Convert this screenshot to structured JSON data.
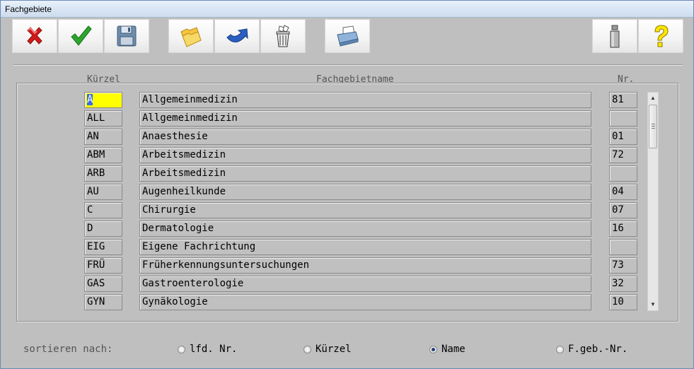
{
  "window": {
    "title": "Fachgebiete"
  },
  "toolbar": [
    {
      "name": "cancel-button",
      "icon": "red-x-icon"
    },
    {
      "name": "confirm-button",
      "icon": "green-check-icon"
    },
    {
      "name": "save-button",
      "icon": "floppy-disk-icon"
    },
    {
      "name": "open-folder-button",
      "icon": "folders-icon"
    },
    {
      "name": "undo-button",
      "icon": "undo-arrow-icon"
    },
    {
      "name": "delete-button",
      "icon": "trash-can-icon"
    },
    {
      "name": "print-button",
      "icon": "printer-icon"
    },
    {
      "name": "info-button",
      "icon": "info-icon"
    },
    {
      "name": "help-button",
      "icon": "question-mark-icon"
    }
  ],
  "columns": {
    "kuerzel": "Kürzel",
    "name": "Fachgebietname",
    "nr": "Nr."
  },
  "rows": [
    {
      "kuerzel": "A",
      "name": "Allgemeinmedizin",
      "nr": "81"
    },
    {
      "kuerzel": "ALL",
      "name": "Allgemeinmedizin",
      "nr": ""
    },
    {
      "kuerzel": "AN",
      "name": "Anaesthesie",
      "nr": "01"
    },
    {
      "kuerzel": "ABM",
      "name": "Arbeitsmedizin",
      "nr": "72"
    },
    {
      "kuerzel": "ARB",
      "name": "Arbeitsmedizin",
      "nr": ""
    },
    {
      "kuerzel": "AU",
      "name": "Augenheilkunde",
      "nr": "04"
    },
    {
      "kuerzel": "C",
      "name": "Chirurgie",
      "nr": "07"
    },
    {
      "kuerzel": "D",
      "name": "Dermatologie",
      "nr": "16"
    },
    {
      "kuerzel": "EIG",
      "name": "Eigene Fachrichtung",
      "nr": ""
    },
    {
      "kuerzel": "FRÜ",
      "name": "Früherkennungsuntersuchungen",
      "nr": "73"
    },
    {
      "kuerzel": "GAS",
      "name": "Gastroenterologie",
      "nr": "32"
    },
    {
      "kuerzel": "GYN",
      "name": "Gynäkologie",
      "nr": "10"
    }
  ],
  "sort": {
    "label": "sortieren nach:",
    "options": [
      {
        "label": "lfd. Nr.",
        "checked": false
      },
      {
        "label": "Kürzel",
        "checked": false
      },
      {
        "label": "Name",
        "checked": true
      },
      {
        "label": "F.geb.-Nr.",
        "checked": false
      }
    ]
  },
  "colors": {
    "active_cell": "#ffff00",
    "selection": "#3a6ee0",
    "background": "#bfbfbf"
  }
}
